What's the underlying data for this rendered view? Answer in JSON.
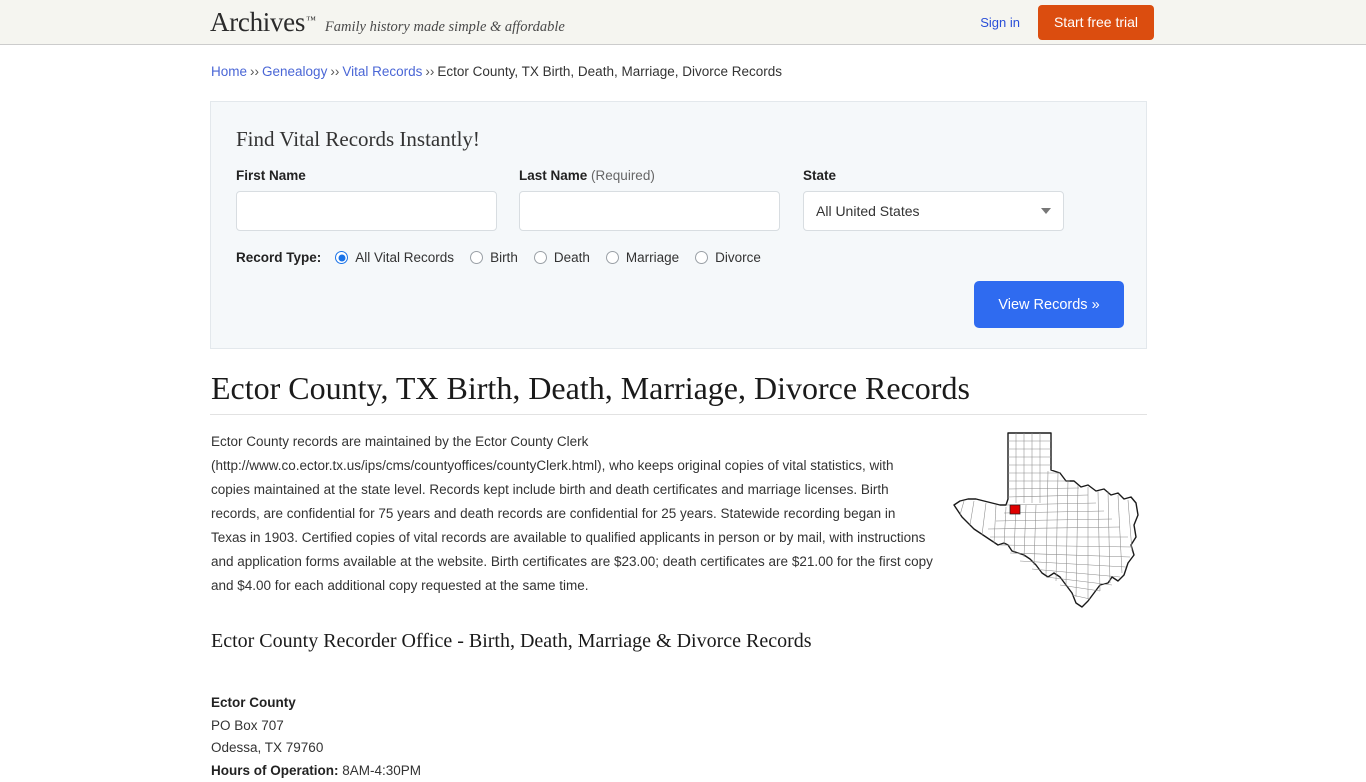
{
  "header": {
    "brand_name": "Archives",
    "brand_tm": "™",
    "tagline": "Family history made simple & affordable",
    "signin_label": "Sign in",
    "trial_label": "Start free trial",
    "background": "#f5f5f0",
    "trial_color": "#db4d0f"
  },
  "breadcrumb": {
    "separator": "››",
    "items": [
      {
        "label": "Home",
        "link": true
      },
      {
        "label": "Genealogy",
        "link": true
      },
      {
        "label": "Vital Records",
        "link": true
      },
      {
        "label": "Ector County, TX Birth, Death, Marriage, Divorce Records",
        "link": false
      }
    ]
  },
  "search_panel": {
    "title": "Find Vital Records Instantly!",
    "first_name": {
      "label": "First Name",
      "value": "",
      "placeholder": ""
    },
    "last_name": {
      "label": "Last Name",
      "required_note": "(Required)",
      "value": "",
      "placeholder": ""
    },
    "state": {
      "label": "State",
      "selected": "All United States"
    },
    "record_type": {
      "label": "Record Type:",
      "options": [
        {
          "label": "All Vital Records",
          "checked": true
        },
        {
          "label": "Birth",
          "checked": false
        },
        {
          "label": "Death",
          "checked": false
        },
        {
          "label": "Marriage",
          "checked": false
        },
        {
          "label": "Divorce",
          "checked": false
        }
      ]
    },
    "submit_label": "View Records »",
    "submit_color": "#2f6bf0",
    "background": "#f5f8fa"
  },
  "main": {
    "page_title": "Ector County, TX Birth, Death, Marriage, Divorce Records",
    "description": "Ector County records are maintained by the Ector County Clerk (http://www.co.ector.tx.us/ips/cms/countyoffices/countyClerk.html), who keeps original copies of vital statistics, with copies maintained at the state level. Records kept include birth and death certificates and marriage licenses. Birth records, are confidential for 75 years and death records are confidential for 25 years. Statewide recording began in Texas in 1903. Certified copies of vital records are available to qualified applicants in person or by mail, with instructions and application forms available at the website. Birth certificates are $23.00; death certificates are $21.00 for the first copy and $4.00 for each additional copy requested at the same time.",
    "map": {
      "name": "texas-county-map",
      "state": "Texas",
      "highlighted_county": "Ector County",
      "highlight_color": "#e00000"
    },
    "section_subtitle": "Ector County Recorder Office - Birth, Death, Marriage & Divorce Records",
    "address": {
      "name": "Ector County",
      "line1": "PO Box 707",
      "line2": "Odessa, TX 79760",
      "hours_label": "Hours of Operation:",
      "hours_value": "8AM-4:30PM"
    }
  }
}
